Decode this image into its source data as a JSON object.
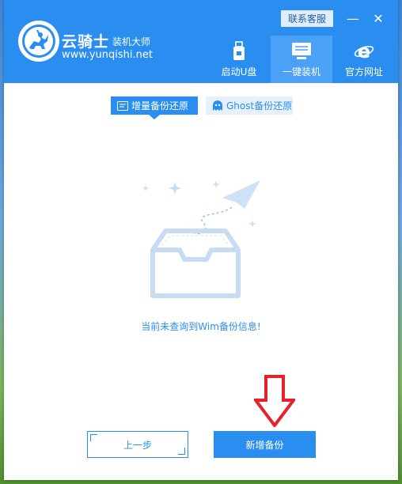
{
  "app": {
    "brand_name": "云骑士",
    "brand_sub": "装机大师",
    "brand_url": "www.yunqishi.net"
  },
  "titlebar": {
    "contact_label": "联系客服",
    "minimize_symbol": "—",
    "close_symbol": "✕"
  },
  "nav": {
    "tabs": [
      {
        "label": "启动U盘",
        "icon": "usb-drive-icon"
      },
      {
        "label": "一键装机",
        "icon": "computer-install-icon",
        "active": true
      },
      {
        "label": "官方网址",
        "icon": "ie-browser-icon"
      }
    ]
  },
  "subtabs": [
    {
      "label": "增量备份还原",
      "icon": "backup-card-icon",
      "active": true
    },
    {
      "label": "Ghost备份还原",
      "icon": "ghost-icon",
      "active": false
    }
  ],
  "main": {
    "empty_message": "当前未查询到Wim备份信息!"
  },
  "buttons": {
    "prev_label": "上一步",
    "new_backup_label": "新增备份"
  },
  "colors": {
    "primary": "#2a8ef0",
    "annotation_arrow": "#e8202a"
  }
}
